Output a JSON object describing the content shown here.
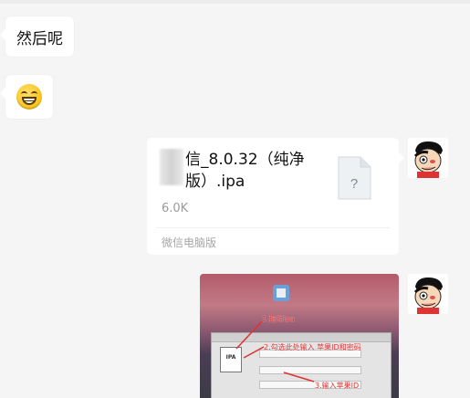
{
  "messages": [
    {
      "type": "text",
      "side": "left",
      "text": "然后呢"
    },
    {
      "type": "emoji",
      "side": "left",
      "emoji": "grinning-face"
    },
    {
      "type": "file",
      "side": "right",
      "name": "信_8.0.32（纯净版）.ipa",
      "size": "6.0K",
      "source": "微信电脑版",
      "file_icon": "unknown-file-icon",
      "file_icon_glyph": "?"
    },
    {
      "type": "image",
      "side": "right",
      "labels": [
        "1.拖动ipa",
        "2.勾选此处输入 苹果ID和密码",
        "3.输入苹果ID"
      ]
    }
  ]
}
